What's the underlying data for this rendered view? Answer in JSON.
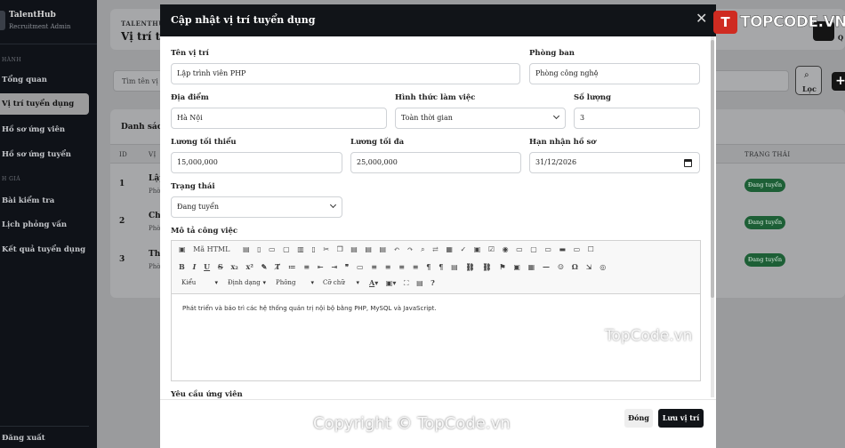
{
  "sidebar": {
    "brand": "TalentHub",
    "brand_sub": "Recruitment Admin",
    "section_main": "HÀNH",
    "section_eval": "H GIÁ",
    "items": [
      "Tổng quan",
      "Vị trí tuyển dụng",
      "Hồ sơ ứng viên",
      "Hồ sơ ứng tuyển",
      "Bài kiểm tra",
      "Lịch phỏng vấn",
      "Kết quả tuyển dụng"
    ],
    "logout": "Đăng xuất"
  },
  "background": {
    "brand_small": "TALENTHUB",
    "page_title": "Vị trí tuy",
    "top_right_text": "Q",
    "search_placeholder": "Tìm tên vị tr",
    "filter_label": "Lọc",
    "add_label": "+",
    "table_title": "Danh sách",
    "col_id": "ID",
    "col_pos": "VỊ",
    "col_status": "TRẠNG THÁI",
    "rows": [
      {
        "id": "1",
        "name": "Lập",
        "sub": "Phò",
        "status": "Đang tuyển"
      },
      {
        "id": "2",
        "name": "Chu",
        "sub": "Phò",
        "status": "Đang tuyển"
      },
      {
        "id": "3",
        "name": "Thi",
        "sub": "Phò",
        "status": "Đang tuyển"
      }
    ]
  },
  "modal": {
    "title": "Cập nhật vị trí tuyển dụng",
    "close_glyph": "✕",
    "fields": {
      "position_label": "Tên vị trí",
      "position_value": "Lập trình viên PHP",
      "department_label": "Phòng ban",
      "department_value": "Phòng công nghệ",
      "location_label": "Địa điểm",
      "location_value": "Hà Nội",
      "worktype_label": "Hình thức làm việc",
      "worktype_value": "Toàn thời gian",
      "quantity_label": "Số lượng",
      "quantity_value": "3",
      "salary_min_label": "Lương tối thiểu",
      "salary_min_value": "15,000,000",
      "salary_max_label": "Lương tối đa",
      "salary_max_value": "25,000,000",
      "deadline_label": "Hạn nhận hồ sơ",
      "deadline_value": "31/12/2026",
      "status_label": "Trạng thái",
      "status_value": "Đang tuyển",
      "description_label": "Mô tả công việc",
      "requirements_label": "Yêu cầu ứng viên"
    },
    "editor": {
      "source_label": "Mã HTML",
      "combo_styles": "Kiểu",
      "combo_format": "Định dạng",
      "combo_font": "Phông",
      "combo_size": "Cỡ chữ",
      "content": "Phát triển và bảo trì các hệ thống quản trị nội bộ bằng PHP, MySQL và JavaScript."
    },
    "close_button": "Đóng",
    "save_button": "Lưu vị trí"
  },
  "watermark": {
    "logo_letter": "T",
    "logo_text": "TOPCODE.VN",
    "mid": "TopCode.vn",
    "bottom": "Copyright © TopCode.vn"
  }
}
